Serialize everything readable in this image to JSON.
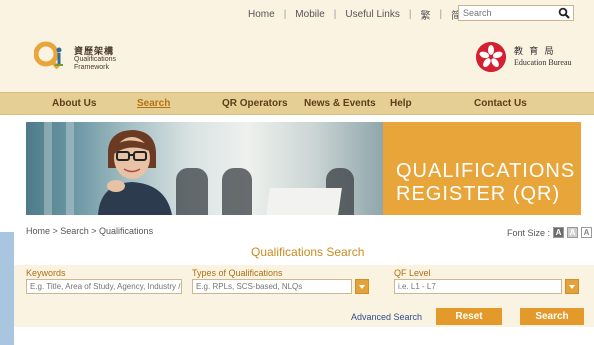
{
  "topbar": {
    "links": [
      "Home",
      "Mobile",
      "Useful Links",
      "繁",
      "简"
    ],
    "search_placeholder": "Search"
  },
  "header": {
    "qf_logo_cn": "資歷架構",
    "qf_logo_en1": "Qualifications",
    "qf_logo_en2": "Framework",
    "edb_cn": "教 育 局",
    "edb_en": "Education Bureau"
  },
  "nav": {
    "items": [
      "About Us",
      "Search",
      "QR Operators",
      "News & Events",
      "Help",
      "Contact Us"
    ],
    "active": "Search"
  },
  "banner": {
    "line1": "QUALIFICATIONS",
    "line2": "REGISTER (QR)"
  },
  "breadcrumb": "Home > Search > Qualifications",
  "font_size_label": "Font Size :",
  "font_size_options": [
    "A",
    "A",
    "A"
  ],
  "page_title": "Qualifications Search",
  "form": {
    "keywords_label": "Keywords",
    "keywords_placeholder": "E.g. Title, Area of Study, Agency, Industry / I",
    "types_label": "Types of Qualifications",
    "types_placeholder": "E.g. RPLs, SCS-based, NLQs",
    "qf_level_label": "QF Level",
    "qf_level_placeholder": "i.e. L1 - L7",
    "advanced_search": "Advanced Search",
    "reset": "Reset",
    "search": "Search"
  },
  "colors": {
    "accent_orange": "#e39a2a",
    "nav_bg": "#e6cf94",
    "cream_bg": "#fbf3e2",
    "title_orange": "#c98b1e"
  }
}
